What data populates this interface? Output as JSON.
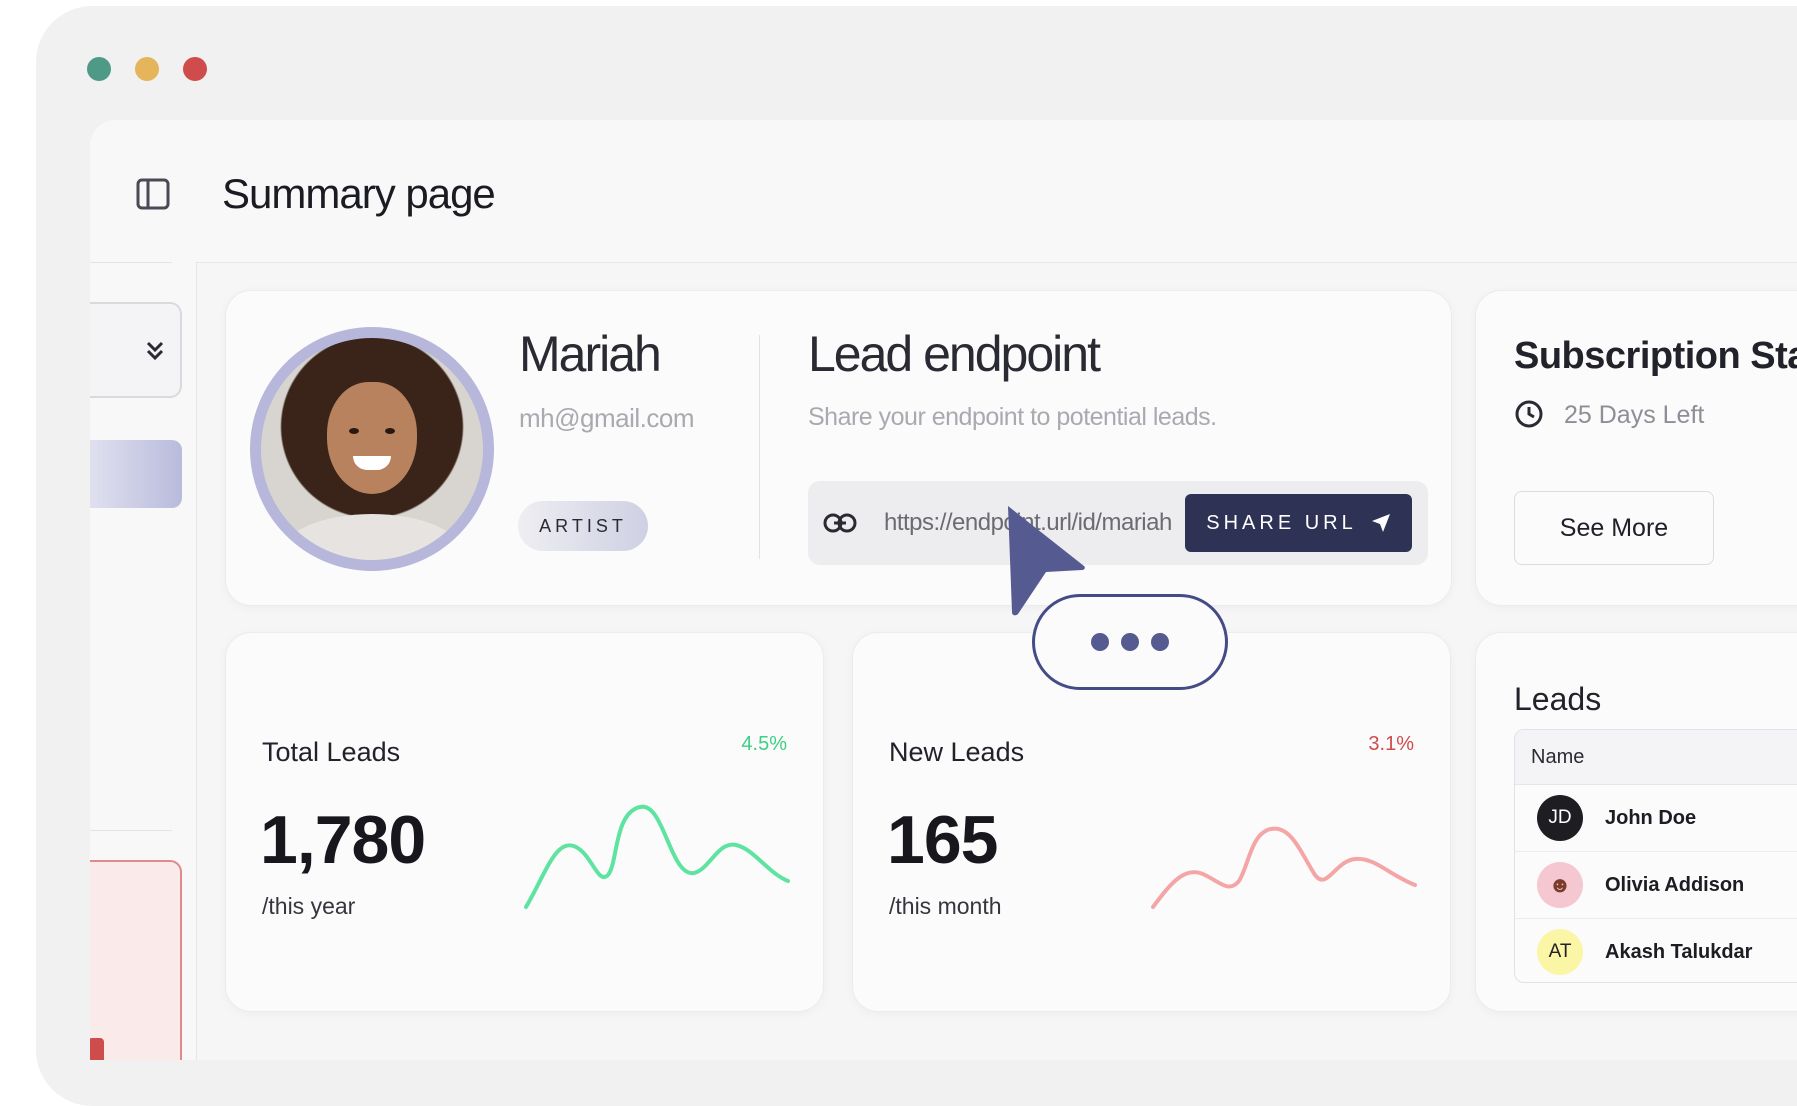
{
  "header": {
    "title": "Summary page"
  },
  "profile": {
    "name": "Mariah",
    "email": "mh@gmail.com",
    "role": "ARTIST"
  },
  "endpoint": {
    "title": "Lead endpoint",
    "subtitle": "Share your endpoint to potential leads.",
    "url": "https://endpoint.url/id/mariah",
    "share_label": "SHARE URL"
  },
  "subscription": {
    "title": "Subscription Sta",
    "days_left": "25 Days Left",
    "see_more_label": "See More"
  },
  "stats": [
    {
      "label": "Total Leads",
      "value": "1,780",
      "period": "/this year",
      "change": "4.5%",
      "color": "#5fe3a1"
    },
    {
      "label": "New Leads",
      "value": "165",
      "period": "/this month",
      "change": "3.1%",
      "color": "#f4a5a5"
    }
  ],
  "leads": {
    "title": "Leads",
    "column_name": "Name",
    "rows": [
      {
        "initials": "JD",
        "name": "John Doe"
      },
      {
        "initials": "",
        "name": "Olivia Addison"
      },
      {
        "initials": "AT",
        "name": "Akash Talukdar"
      }
    ]
  },
  "colors": {
    "accent": "#2e3356",
    "positive": "#3fcf84",
    "negative": "#cf4c4c",
    "cursor": "#555a90"
  },
  "icons": [
    "sidebar-toggle-icon",
    "chevrons-down-icon",
    "link-icon",
    "send-icon",
    "clock-icon",
    "cursor-arrow-icon",
    "typing-dots-icon"
  ]
}
